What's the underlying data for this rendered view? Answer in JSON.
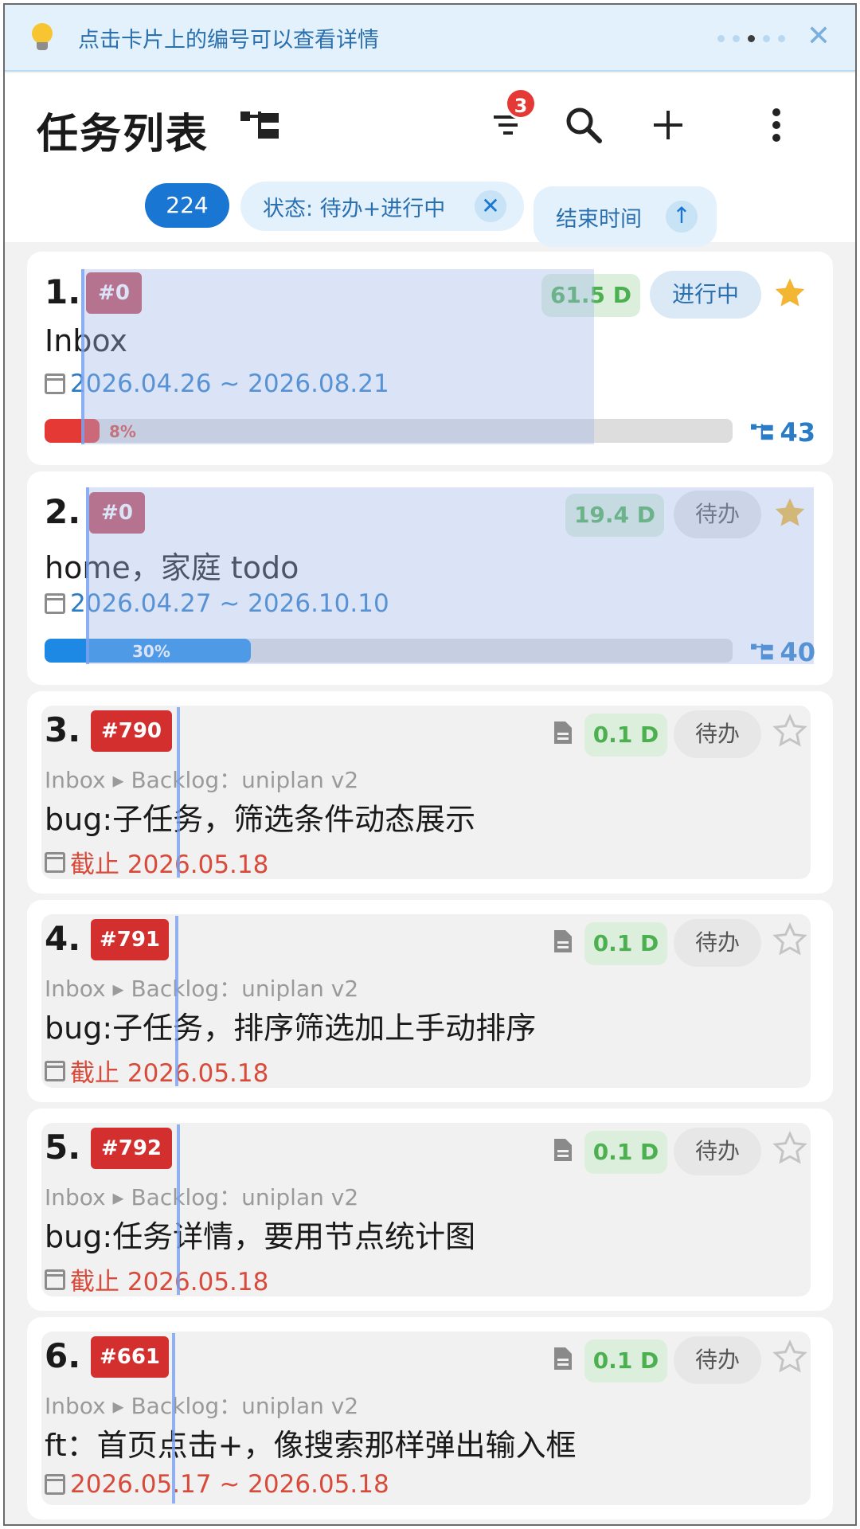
{
  "tip": {
    "text": "点击卡片上的编号可以查看详情",
    "close_icon": "close-icon"
  },
  "header": {
    "title": "任务列表",
    "filter_badge": "3"
  },
  "chips": {
    "count": "224",
    "status_filter": "状态: 待办+进行中",
    "sort": "结束时间"
  },
  "tasks": [
    {
      "num": "1.",
      "id": "#0",
      "days": "61.5 D",
      "status": "进行中",
      "starred": true,
      "title": "Inbox",
      "date": "2026.04.26 ~ 2026.08.21",
      "progress": 8,
      "progress_label": "8%",
      "subtasks": "43"
    },
    {
      "num": "2.",
      "id": "#0",
      "days": "19.4 D",
      "status": "待办",
      "starred": true,
      "title": "home，家庭 todo",
      "date": "2026.04.27 ~ 2026.10.10",
      "progress": 30,
      "progress_label": "30%",
      "subtasks": "40"
    },
    {
      "num": "3.",
      "id": "#790",
      "days": "0.1 D",
      "status": "待办",
      "starred": false,
      "crumb": "Inbox ▸ Backlog：uniplan v2",
      "title": "bug:子任务，筛选条件动态展示",
      "date": "截止 2026.05.18"
    },
    {
      "num": "4.",
      "id": "#791",
      "days": "0.1 D",
      "status": "待办",
      "starred": false,
      "crumb": "Inbox ▸ Backlog：uniplan v2",
      "title": "bug:子任务，排序筛选加上手动排序",
      "date": "截止 2026.05.18"
    },
    {
      "num": "5.",
      "id": "#792",
      "days": "0.1 D",
      "status": "待办",
      "starred": false,
      "crumb": "Inbox ▸ Backlog：uniplan v2",
      "title": "bug:任务详情，要用节点统计图",
      "date": "截止 2026.05.18"
    },
    {
      "num": "6.",
      "id": "#661",
      "days": "0.1 D",
      "status": "待办",
      "starred": false,
      "crumb": "Inbox ▸ Backlog：uniplan v2",
      "title": "ft：首页点击+，像搜索那样弹出输入框",
      "date": "2026.05.17 ~ 2026.05.18"
    }
  ],
  "colors": {
    "accent": "#1976d2",
    "progress_red": "#e53935",
    "progress_blue": "#1e88e5",
    "star_gold": "#f2b632",
    "due_red": "#d84a3a"
  }
}
